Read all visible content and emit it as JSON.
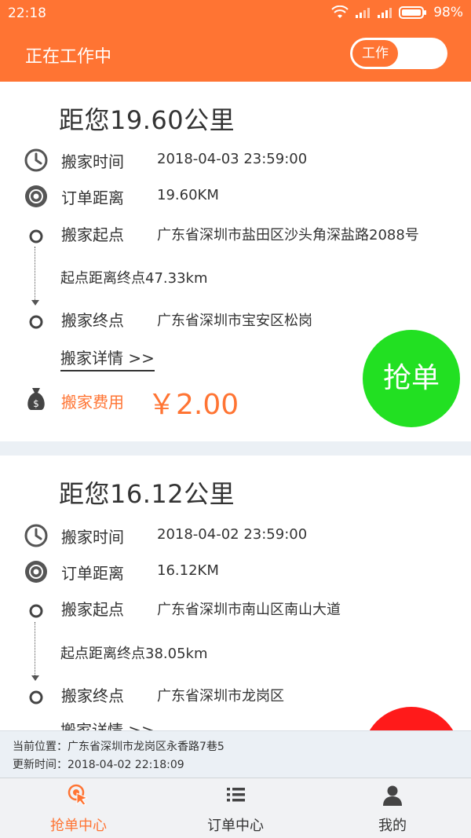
{
  "status_bar": {
    "time": "22:18",
    "battery": "98%"
  },
  "header": {
    "title": "正在工作中",
    "toggle_label": "工作"
  },
  "colors": {
    "accent": "#ff7433",
    "grab_green": "#22e022",
    "grab_red": "#ff1a1a"
  },
  "orders": [
    {
      "distance_title": "距您19.60公里",
      "time_label": "搬家时间",
      "time_value": "2018-04-03 23:59:00",
      "distance_label": "订单距离",
      "distance_value": "19.60KM",
      "start_label": "搬家起点",
      "start_value": "广东省深圳市盐田区沙头角深盐路2088号",
      "between": "起点距离终点47.33km",
      "end_label": "搬家终点",
      "end_value": "广东省深圳市宝安区松岗",
      "detail_link": "搬家详情 >>",
      "fee_label": "搬家费用",
      "fee_value": "￥2.00",
      "grab_label": "抢单"
    },
    {
      "distance_title": "距您16.12公里",
      "time_label": "搬家时间",
      "time_value": "2018-04-02 23:59:00",
      "distance_label": "订单距离",
      "distance_value": "16.12KM",
      "start_label": "搬家起点",
      "start_value": "广东省深圳市南山区南山大道",
      "between": "起点距离终点38.05km",
      "end_label": "搬家终点",
      "end_value": "广东省深圳市龙岗区",
      "detail_link": "搬家详情 >>"
    }
  ],
  "location": {
    "current": "当前位置：广东省深圳市龙岗区永香路7巷5",
    "updated": "更新时间：2018-04-02 22:18:09"
  },
  "nav": [
    {
      "label": "抢单中心",
      "icon": "cursor-click-icon"
    },
    {
      "label": "订单中心",
      "icon": "list-icon"
    },
    {
      "label": "我的",
      "icon": "user-icon"
    }
  ]
}
